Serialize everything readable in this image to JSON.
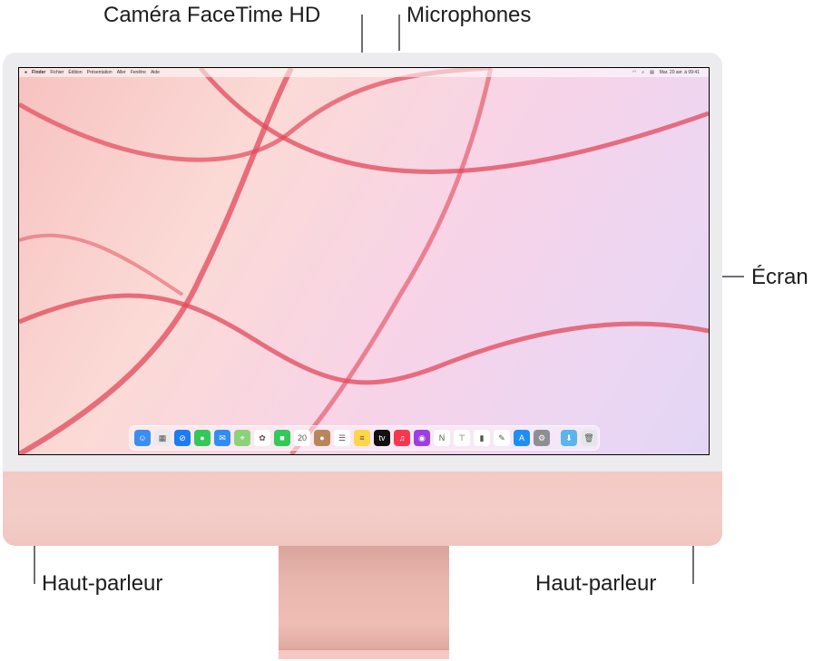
{
  "callouts": {
    "camera": "Caméra FaceTime HD",
    "microphones": "Microphones",
    "screen": "Écran",
    "speaker_left": "Haut-parleur",
    "speaker_right": "Haut-parleur"
  },
  "menubar": {
    "apple_icon": "",
    "items": [
      "Finder",
      "Fichier",
      "Édition",
      "Présentation",
      "Aller",
      "Fenêtre",
      "Aide"
    ],
    "status": {
      "wifi_icon": "wifi-icon",
      "search_icon": "search-icon",
      "control_center_icon": "control-center-icon",
      "datetime": "Mar. 20 avr. à 09:41"
    }
  },
  "dock": {
    "apps": [
      {
        "name": "Finder",
        "icon": "finder-icon",
        "color": "#3a8ef0",
        "glyph": "☺"
      },
      {
        "name": "Launchpad",
        "icon": "launchpad-icon",
        "color": "#e9e9ee",
        "glyph": "▦"
      },
      {
        "name": "Safari",
        "icon": "safari-icon",
        "color": "#1e7cf2",
        "glyph": "⊘"
      },
      {
        "name": "Messages",
        "icon": "messages-icon",
        "color": "#34c759",
        "glyph": "●"
      },
      {
        "name": "Mail",
        "icon": "mail-icon",
        "color": "#2f8cf5",
        "glyph": "✉"
      },
      {
        "name": "Plans",
        "icon": "maps-icon",
        "color": "#8dd17a",
        "glyph": "⌖"
      },
      {
        "name": "Photos",
        "icon": "photos-icon",
        "color": "#ffffff",
        "glyph": "✿"
      },
      {
        "name": "FaceTime",
        "icon": "facetime-icon",
        "color": "#34c759",
        "glyph": "■"
      },
      {
        "name": "Calendrier",
        "icon": "calendar-icon",
        "color": "#ffffff",
        "glyph": "20"
      },
      {
        "name": "Contacts",
        "icon": "contacts-icon",
        "color": "#b8865a",
        "glyph": "●"
      },
      {
        "name": "Rappels",
        "icon": "reminders-icon",
        "color": "#ffffff",
        "glyph": "☰"
      },
      {
        "name": "Notes",
        "icon": "notes-icon",
        "color": "#ffd54a",
        "glyph": "≡"
      },
      {
        "name": "TV",
        "icon": "tv-icon",
        "color": "#111111",
        "glyph": "tv"
      },
      {
        "name": "Musique",
        "icon": "music-icon",
        "color": "#f6384f",
        "glyph": "♫"
      },
      {
        "name": "Podcasts",
        "icon": "podcasts-icon",
        "color": "#9b3fe0",
        "glyph": "◉"
      },
      {
        "name": "News",
        "icon": "news-icon",
        "color": "#ffffff",
        "glyph": "N"
      },
      {
        "name": "Keynote",
        "icon": "keynote-icon",
        "color": "#ffffff",
        "glyph": "⊤"
      },
      {
        "name": "Numbers",
        "icon": "numbers-icon",
        "color": "#ffffff",
        "glyph": "▮"
      },
      {
        "name": "Pages",
        "icon": "pages-icon",
        "color": "#ffffff",
        "glyph": "✎"
      },
      {
        "name": "App Store",
        "icon": "app-store-icon",
        "color": "#1e8ef5",
        "glyph": "A"
      },
      {
        "name": "Préférences Système",
        "icon": "system-preferences-icon",
        "color": "#8e8e93",
        "glyph": "⚙"
      }
    ],
    "extras": [
      {
        "name": "Téléchargements",
        "icon": "downloads-folder-icon",
        "color": "#5ab4ee",
        "glyph": "⬇"
      },
      {
        "name": "Corbeille",
        "icon": "trash-icon",
        "color": "#e6e6ea",
        "glyph": "🗑"
      }
    ]
  }
}
